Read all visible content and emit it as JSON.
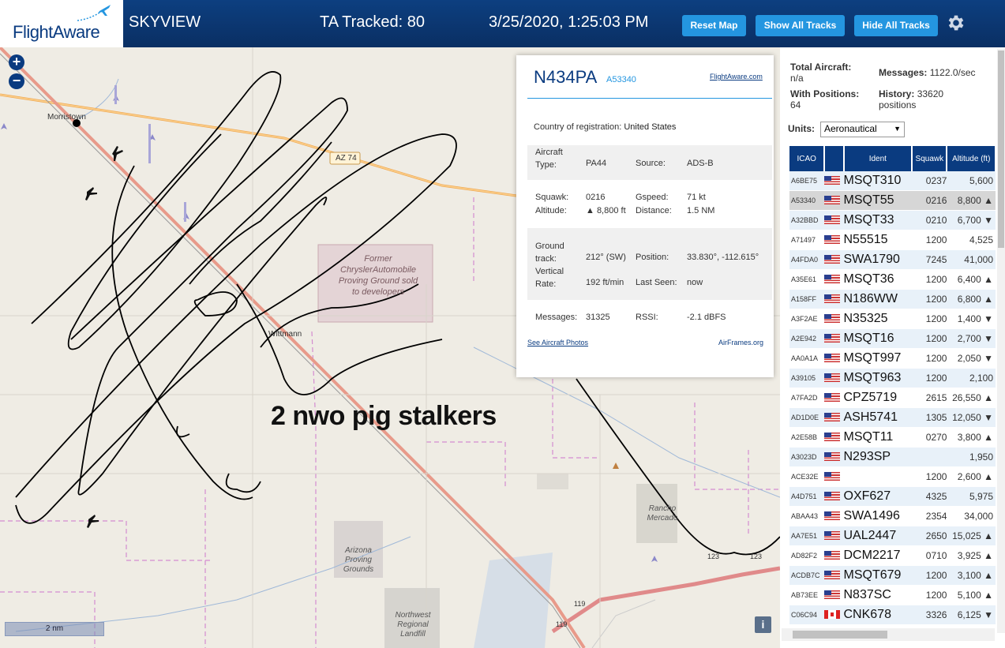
{
  "header": {
    "logo_text": "FlightAware",
    "app_title": "SKYVIEW",
    "tracked": "TA Tracked: 80",
    "datetime": "3/25/2020, 1:25:03 PM",
    "buttons": {
      "reset": "Reset Map",
      "show_all": "Show All Tracks",
      "hide_all": "Hide All Tracks"
    },
    "accent_color": "#2496e0",
    "bar_color": "#0a3b80"
  },
  "map": {
    "zoom_in": "+",
    "zoom_out": "−",
    "scale": "2 nm",
    "info": "i",
    "annotation": "2 nwo pig stalkers",
    "labels": {
      "morristown": "Morristown",
      "az74": "AZ 74",
      "former_chrysler": "Former ChryslerAutomobile Proving Ground sold to developers",
      "wittmann": "Wittmann",
      "rancho": "Rancho Mercado",
      "arizona_pg": "Arizona Proving Grounds",
      "northwest": "Northwest Regional Landfill",
      "r123a": "123",
      "r123b": "123",
      "r119a": "119",
      "r119b": "119"
    }
  },
  "popup": {
    "callsign": "N434PA",
    "hex": "A53340",
    "fa_link": "FlightAware.com",
    "country_label": "Country of registration:",
    "country": "United States",
    "type_label": "Aircraft Type:",
    "type_label_1": "Aircraft",
    "type_label_2": "Type:",
    "type": "PA44",
    "source_label": "Source:",
    "source": "ADS-B",
    "squawk_label": "Squawk:",
    "squawk": "0216",
    "gspeed_label": "Gspeed:",
    "gspeed": "71 kt",
    "altitude_label": "Altitude:",
    "altitude": "▲ 8,800 ft",
    "distance_label": "Distance:",
    "distance": "1.5 NM",
    "ground_label_1": "Ground",
    "ground_label_2": "track:",
    "ground": "212° (SW)",
    "position_label": "Position:",
    "position": "33.830°, -112.615°",
    "vr_label_1": "Vertical",
    "vr_label_2": "Rate:",
    "vr": "192 ft/min",
    "seen_label": "Last Seen:",
    "seen": "now",
    "messages_label": "Messages:",
    "messages": "31325",
    "rssi_label": "RSSI:",
    "rssi": "-2.1 dBFS",
    "photos_link": "See Aircraft Photos",
    "airframes_link": "AirFrames.org"
  },
  "panel": {
    "total_label": "Total Aircraft:",
    "total": "n/a",
    "messages_label": "Messages:",
    "messages": "1122.0/sec",
    "with_pos_label": "With Positions:",
    "with_pos": "64",
    "history_label": "History:",
    "history": "33620 positions",
    "units_label": "Units:",
    "units": "Aeronautical",
    "columns": {
      "icao": "ICAO",
      "ident": "Ident",
      "squawk": "Squawk",
      "altitude": "Altitude (ft)"
    },
    "rows": [
      {
        "icao": "A6BE75",
        "flag": "us",
        "ident": "MSQT310",
        "squawk": "0237",
        "alt": "5,600"
      },
      {
        "icao": "A53340",
        "flag": "us",
        "ident": "MSQT55",
        "squawk": "0216",
        "alt": "8,800 ▲"
      },
      {
        "icao": "A32BBD",
        "flag": "us",
        "ident": "MSQT33",
        "squawk": "0210",
        "alt": "6,700 ▼"
      },
      {
        "icao": "A71497",
        "flag": "us",
        "ident": "N55515",
        "squawk": "1200",
        "alt": "4,525"
      },
      {
        "icao": "A4FDA0",
        "flag": "us",
        "ident": "SWA1790",
        "squawk": "7245",
        "alt": "41,000"
      },
      {
        "icao": "A35E61",
        "flag": "us",
        "ident": "MSQT36",
        "squawk": "1200",
        "alt": "6,400 ▲"
      },
      {
        "icao": "A158FF",
        "flag": "us",
        "ident": "N186WW",
        "squawk": "1200",
        "alt": "6,800 ▲"
      },
      {
        "icao": "A3F2AE",
        "flag": "us",
        "ident": "N35325",
        "squawk": "1200",
        "alt": "1,400 ▼"
      },
      {
        "icao": "A2E942",
        "flag": "us",
        "ident": "MSQT16",
        "squawk": "1200",
        "alt": "2,700 ▼"
      },
      {
        "icao": "AA0A1A",
        "flag": "us",
        "ident": "MSQT997",
        "squawk": "1200",
        "alt": "2,050 ▼"
      },
      {
        "icao": "A39105",
        "flag": "us",
        "ident": "MSQT963",
        "squawk": "1200",
        "alt": "2,100"
      },
      {
        "icao": "A7FA2D",
        "flag": "us",
        "ident": "CPZ5719",
        "squawk": "2615",
        "alt": "26,550 ▲"
      },
      {
        "icao": "AD1D0E",
        "flag": "us",
        "ident": "ASH5741",
        "squawk": "1305",
        "alt": "12,050 ▼"
      },
      {
        "icao": "A2E58B",
        "flag": "us",
        "ident": "MSQT11",
        "squawk": "0270",
        "alt": "3,800 ▲"
      },
      {
        "icao": "A3023D",
        "flag": "us",
        "ident": "N293SP",
        "squawk": "",
        "alt": "1,950"
      },
      {
        "icao": "ACE32E",
        "flag": "us",
        "ident": "",
        "squawk": "1200",
        "alt": "2,600 ▲"
      },
      {
        "icao": "A4D751",
        "flag": "us",
        "ident": "OXF627",
        "squawk": "4325",
        "alt": "5,975"
      },
      {
        "icao": "ABAA43",
        "flag": "us",
        "ident": "SWA1496",
        "squawk": "2354",
        "alt": "34,000"
      },
      {
        "icao": "AA7E51",
        "flag": "us",
        "ident": "UAL2447",
        "squawk": "2650",
        "alt": "15,025 ▲"
      },
      {
        "icao": "AD82F2",
        "flag": "us",
        "ident": "DCM2217",
        "squawk": "0710",
        "alt": "3,925 ▲"
      },
      {
        "icao": "ACDB7C",
        "flag": "us",
        "ident": "MSQT679",
        "squawk": "1200",
        "alt": "3,100 ▲"
      },
      {
        "icao": "AB73EE",
        "flag": "us",
        "ident": "N837SC",
        "squawk": "1200",
        "alt": "5,100 ▲"
      },
      {
        "icao": "C06C94",
        "flag": "ca",
        "ident": "CNK678",
        "squawk": "3326",
        "alt": "6,125 ▼"
      }
    ],
    "selected_index": 1
  }
}
